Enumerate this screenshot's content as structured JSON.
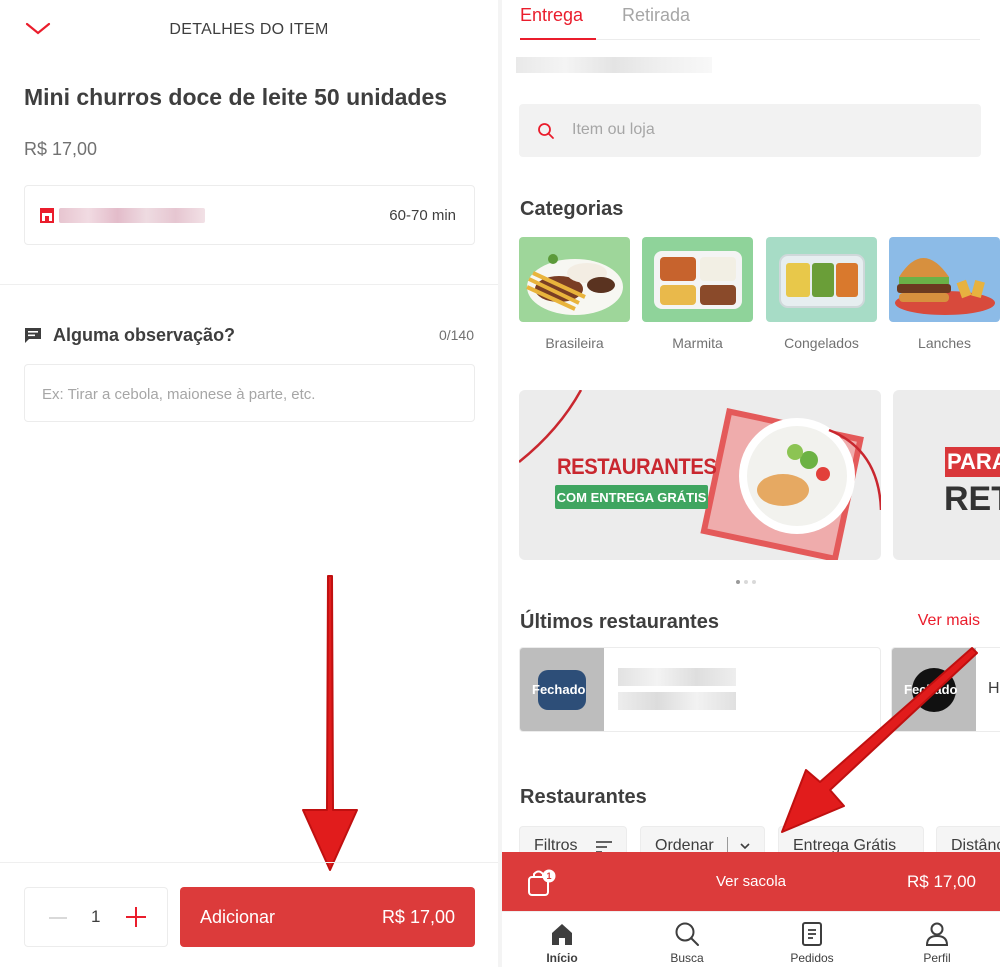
{
  "left": {
    "header": {
      "title": "DETALHES DO ITEM"
    },
    "item": {
      "name": "Mini churros doce de leite 50 unidades",
      "price": "R$ 17,00"
    },
    "store": {
      "delivery_time": "60-70 min"
    },
    "notes": {
      "label": "Alguma observação?",
      "counter": "0/140",
      "placeholder": "Ex: Tirar a cebola, maionese à parte, etc."
    },
    "footer": {
      "quantity": "1",
      "add_label": "Adicionar",
      "add_price": "R$ 17,00"
    }
  },
  "right": {
    "tabs": [
      {
        "label": "Entrega",
        "active": true
      },
      {
        "label": "Retirada",
        "active": false
      }
    ],
    "search": {
      "placeholder": "Item ou loja"
    },
    "categories": {
      "title": "Categorias",
      "items": [
        {
          "label": "Brasileira"
        },
        {
          "label": "Marmita"
        },
        {
          "label": "Congelados"
        },
        {
          "label": "Lanches"
        }
      ]
    },
    "banners": [
      {
        "title": "RESTAURANTES",
        "subtitle": "COM ENTREGA GRÁTIS"
      },
      {
        "title": "PARA",
        "subtitle": "RETI"
      }
    ],
    "recent": {
      "title": "Últimos restaurantes",
      "more": "Ver mais",
      "cards": [
        {
          "status": "Fechado"
        },
        {
          "status": "Fechado",
          "name_fragment": "H"
        }
      ]
    },
    "restaurants": {
      "title": "Restaurantes",
      "filters": [
        {
          "label": "Filtros"
        },
        {
          "label": "Ordenar"
        },
        {
          "label": "Entrega Grátis"
        },
        {
          "label": "Distânc"
        }
      ]
    },
    "bag": {
      "label": "Ver sacola",
      "price": "R$ 17,00",
      "count": "1"
    },
    "nav": [
      {
        "label": "Início",
        "icon": "home-icon",
        "active": true
      },
      {
        "label": "Busca",
        "icon": "search-icon",
        "active": false
      },
      {
        "label": "Pedidos",
        "icon": "orders-icon",
        "active": false
      },
      {
        "label": "Perfil",
        "icon": "profile-icon",
        "active": false
      }
    ]
  },
  "colors": {
    "brand": "#ea1d2c",
    "button": "#dc3b3b",
    "text": "#3e3e3e",
    "muted": "#717171"
  }
}
